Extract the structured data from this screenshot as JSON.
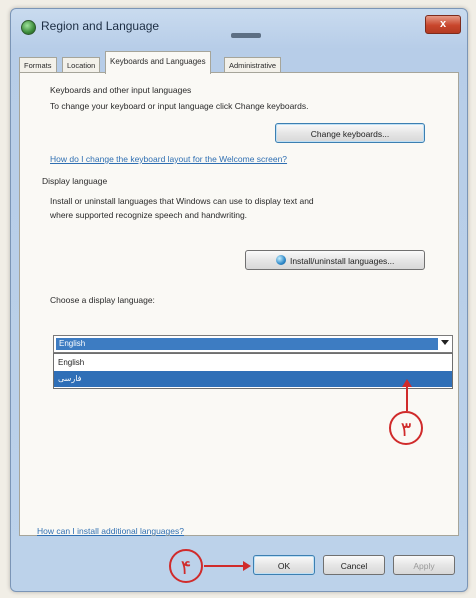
{
  "window": {
    "title": "Region and Language",
    "close_label": "x"
  },
  "tabs": [
    {
      "label": "Formats"
    },
    {
      "label": "Location"
    },
    {
      "label": "Keyboards and Languages",
      "active": true
    },
    {
      "label": "Administrative"
    }
  ],
  "keyboards": {
    "heading": "Keyboards and other input languages",
    "description": "To change your keyboard or input language click Change keyboards.",
    "change_button": "Change keyboards...",
    "help_link": "How do I change the keyboard layout for the Welcome screen?"
  },
  "display_language": {
    "heading": "Display language",
    "description_line1": "Install or uninstall languages that Windows can use to display text and",
    "description_line2": "where supported recognize speech and handwriting.",
    "install_button": "Install/uninstall languages...",
    "choose_label": "Choose a display language:",
    "selected_value": "English",
    "options": [
      "English",
      "فارسی"
    ],
    "highlighted_option": "فارسی"
  },
  "footer": {
    "additional_link": "How can I install additional languages?",
    "ok_label": "OK",
    "cancel_label": "Cancel",
    "apply_label": "Apply"
  },
  "annotations": {
    "step3": "۳",
    "step4": "۴"
  },
  "colors": {
    "accent_blue": "#3d7cc2",
    "annotation_red": "#d02b2b",
    "link_blue": "#2f6fb2"
  }
}
